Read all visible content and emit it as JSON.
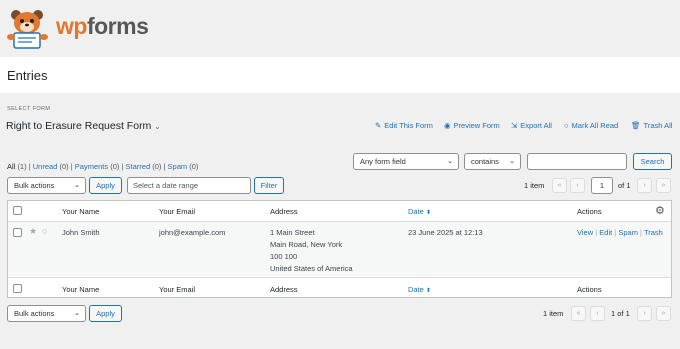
{
  "brand": {
    "name_wp": "wp",
    "name_forms": "forms"
  },
  "page": {
    "title": "Entries",
    "select_form_label": "SELECT FORM",
    "form_name": "Right to Erasure Request Form"
  },
  "actions": [
    {
      "label": "Edit This Form",
      "icon": "pencil-icon"
    },
    {
      "label": "Preview Form",
      "icon": "eye-icon"
    },
    {
      "label": "Export All",
      "icon": "export-icon"
    },
    {
      "label": "Mark All Read",
      "icon": "circle-icon"
    },
    {
      "label": "Trash All",
      "icon": "trash-icon"
    }
  ],
  "filters": {
    "all": "All",
    "all_count": "(1)",
    "unread": "Unread",
    "unread_count": "(0)",
    "payments": "Payments",
    "payments_count": "(0)",
    "starred": "Starred",
    "starred_count": "(0)",
    "spam": "Spam",
    "spam_count": "(0)",
    "sep": "|"
  },
  "search": {
    "field": "Any form field",
    "op": "contains",
    "value": "",
    "button": "Search"
  },
  "toolbar": {
    "bulk": "Bulk actions",
    "apply": "Apply",
    "date_placeholder": "Select a date range",
    "filter": "Filter"
  },
  "pagination": {
    "items": "1 item",
    "first": "«",
    "prev": "‹",
    "next": "›",
    "last": "»",
    "current": "1",
    "of": "of 1",
    "bottom": "1 of 1"
  },
  "columns": {
    "name": "Your Name",
    "email": "Your Email",
    "address": "Address",
    "date": "Date",
    "actions": "Actions"
  },
  "rows": [
    {
      "name": "John Smith",
      "email": "john@example.com",
      "address": [
        "1 Main Street",
        "Main Road, New York",
        "100 100",
        "United States of America"
      ],
      "date": "23 June 2025 at 12:13",
      "view": "View",
      "edit": "Edit",
      "spam": "Spam",
      "trash": "Trash",
      "sep": "|"
    }
  ],
  "colors": {
    "accent": "#2271b1",
    "logo_orange": "#e27730"
  }
}
